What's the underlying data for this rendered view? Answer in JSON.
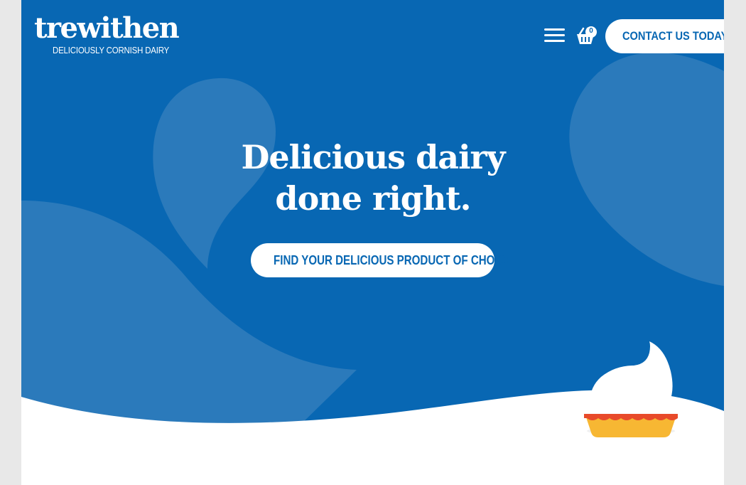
{
  "brand": {
    "name": "trewithen",
    "tagline": "DELICIOUSLY CORNISH DAIRY"
  },
  "header": {
    "menu_icon": "hamburger-menu-icon",
    "basket_icon": "basket-icon",
    "basket_count": "0",
    "contact_label": "CONTACT US TODAY"
  },
  "hero": {
    "headline_line1": "Delicious dairy",
    "headline_line2": "done right.",
    "cta_label": "FIND YOUR DELICIOUS PRODUCT OF CHOICE",
    "illustration": "cream-topped-pie-icon"
  },
  "colors": {
    "brand_blue": "#0867b3",
    "shape_blue": "#2b7abb",
    "white": "#ffffff",
    "pie_crust": "#f7b733",
    "pie_rim": "#e84a2a"
  }
}
